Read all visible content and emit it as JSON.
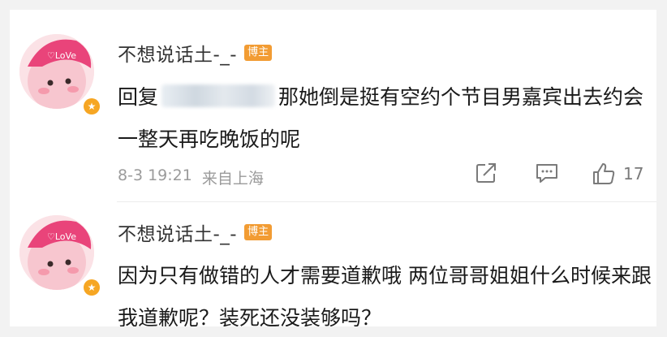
{
  "comments": [
    {
      "username": "不想说话土-_-",
      "badge": "博主",
      "text_prefix": "回复",
      "text_suffix": "那她倒是挺有空约个节目男嘉宾出去约会一整天再吃晚饭的呢",
      "date": "8-3 19:21",
      "location": "来自上海",
      "likes": "17"
    },
    {
      "username": "不想说话土-_-",
      "badge": "博主",
      "text": "因为只有做错的人才需要道歉哦 两位哥哥姐姐什么时候来跟我道歉呢？装死还没装够吗？"
    }
  ],
  "icons": {
    "share": "share-icon",
    "comment": "comment-icon",
    "like": "thumbs-up-icon",
    "verified": "verified-star-icon"
  },
  "colors": {
    "badge_bg": "#f29c33",
    "verified": "#f6a623",
    "avatar_bg": "#fbe2e6"
  }
}
